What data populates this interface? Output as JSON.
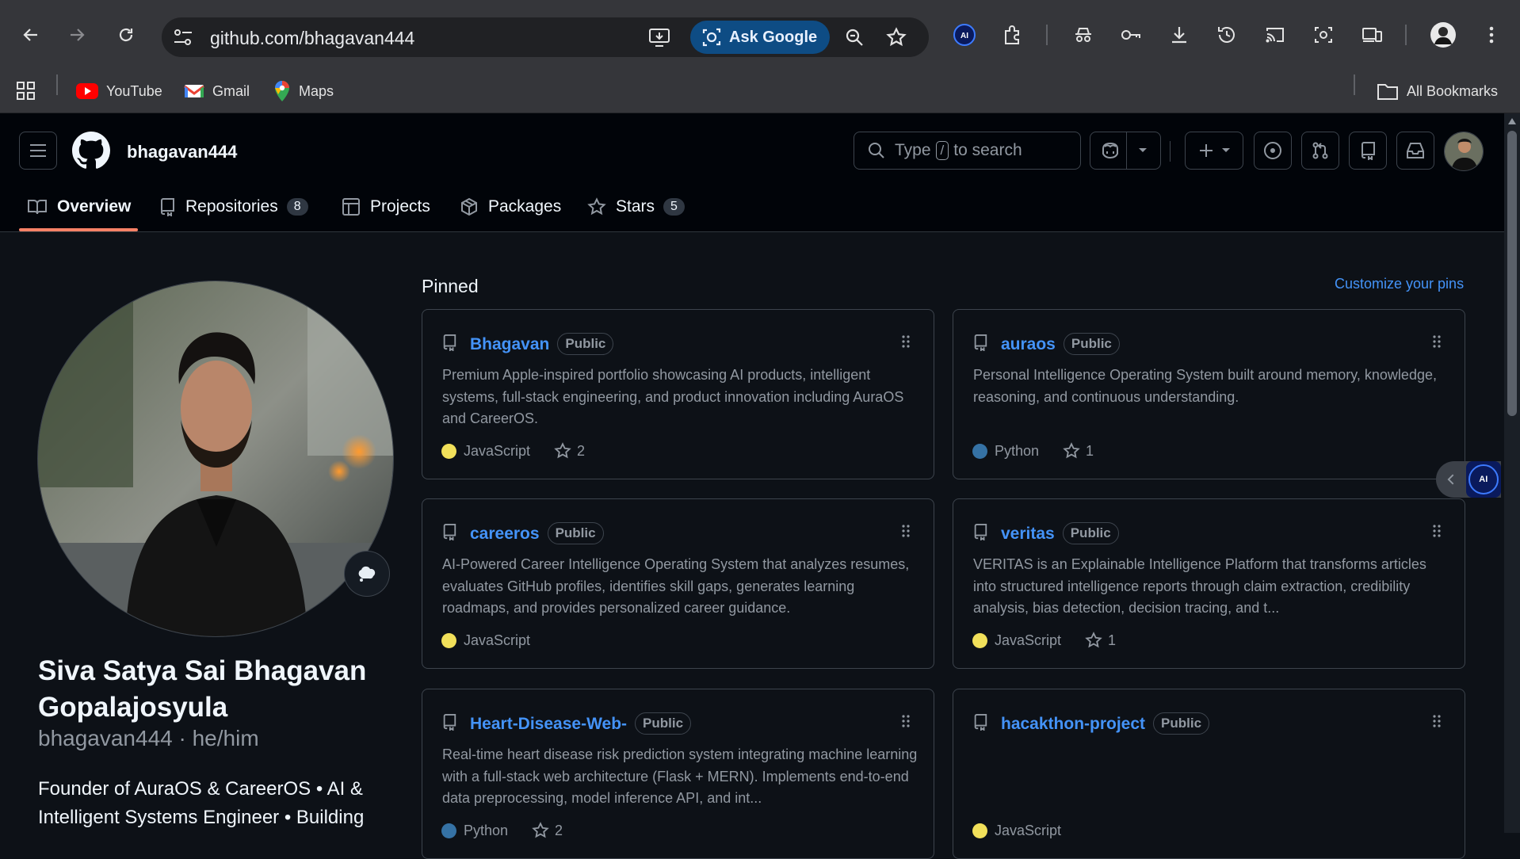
{
  "browser": {
    "url": "github.com/bhagavan444",
    "ask_google": "Ask Google",
    "bookmarks": [
      {
        "label": "YouTube",
        "icon": "youtube-icon"
      },
      {
        "label": "Gmail",
        "icon": "gmail-icon"
      },
      {
        "label": "Maps",
        "icon": "maps-icon"
      }
    ],
    "all_bookmarks": "All Bookmarks"
  },
  "github": {
    "username": "bhagavan444",
    "search_prefix": "Type",
    "search_key": "/",
    "search_suffix": "to search",
    "tabs": [
      {
        "label": "Overview",
        "count": ""
      },
      {
        "label": "Repositories",
        "count": "8"
      },
      {
        "label": "Projects",
        "count": ""
      },
      {
        "label": "Packages",
        "count": ""
      },
      {
        "label": "Stars",
        "count": "5"
      }
    ]
  },
  "profile": {
    "full_name": "Siva Satya Sai Bhagavan Gopalajosyula",
    "login": "bhagavan444 · he/him",
    "bio": "Founder of AuraOS & CareerOS • AI & Intelligent Systems Engineer • Building"
  },
  "pinned": {
    "title": "Pinned",
    "customize": "Customize your pins",
    "repos": [
      {
        "name": "Bhagavan",
        "visibility": "Public",
        "description": "Premium Apple-inspired portfolio showcasing AI products, intelligent systems, full-stack engineering, and product innovation including AuraOS and CareerOS.",
        "language": "JavaScript",
        "lang_color": "#f1e05a",
        "stars": "2"
      },
      {
        "name": "auraos",
        "visibility": "Public",
        "description": "Personal Intelligence Operating System built around memory, knowledge, reasoning, and continuous understanding.",
        "language": "Python",
        "lang_color": "#3572A5",
        "stars": "1"
      },
      {
        "name": "careeros",
        "visibility": "Public",
        "description": "AI-Powered Career Intelligence Operating System that analyzes resumes, evaluates GitHub profiles, identifies skill gaps, generates learning roadmaps, and provides personalized career guidance.",
        "language": "JavaScript",
        "lang_color": "#f1e05a",
        "stars": ""
      },
      {
        "name": "veritas",
        "visibility": "Public",
        "description": "VERITAS is an Explainable Intelligence Platform that transforms articles into structured intelligence reports through claim extraction, credibility analysis, bias detection, decision tracing, and t...",
        "language": "JavaScript",
        "lang_color": "#f1e05a",
        "stars": "1"
      },
      {
        "name": "Heart-Disease-Web-",
        "visibility": "Public",
        "description": "Real-time heart disease risk prediction system integrating machine learning with a full-stack web architecture (Flask + MERN). Implements end-to-end data preprocessing, model inference API, and int...",
        "language": "Python",
        "lang_color": "#3572A5",
        "stars": "2"
      },
      {
        "name": "hacakthon-project",
        "visibility": "Public",
        "description": "",
        "language": "JavaScript",
        "lang_color": "#f1e05a",
        "stars": ""
      }
    ]
  },
  "widget": {
    "label": "AI"
  }
}
